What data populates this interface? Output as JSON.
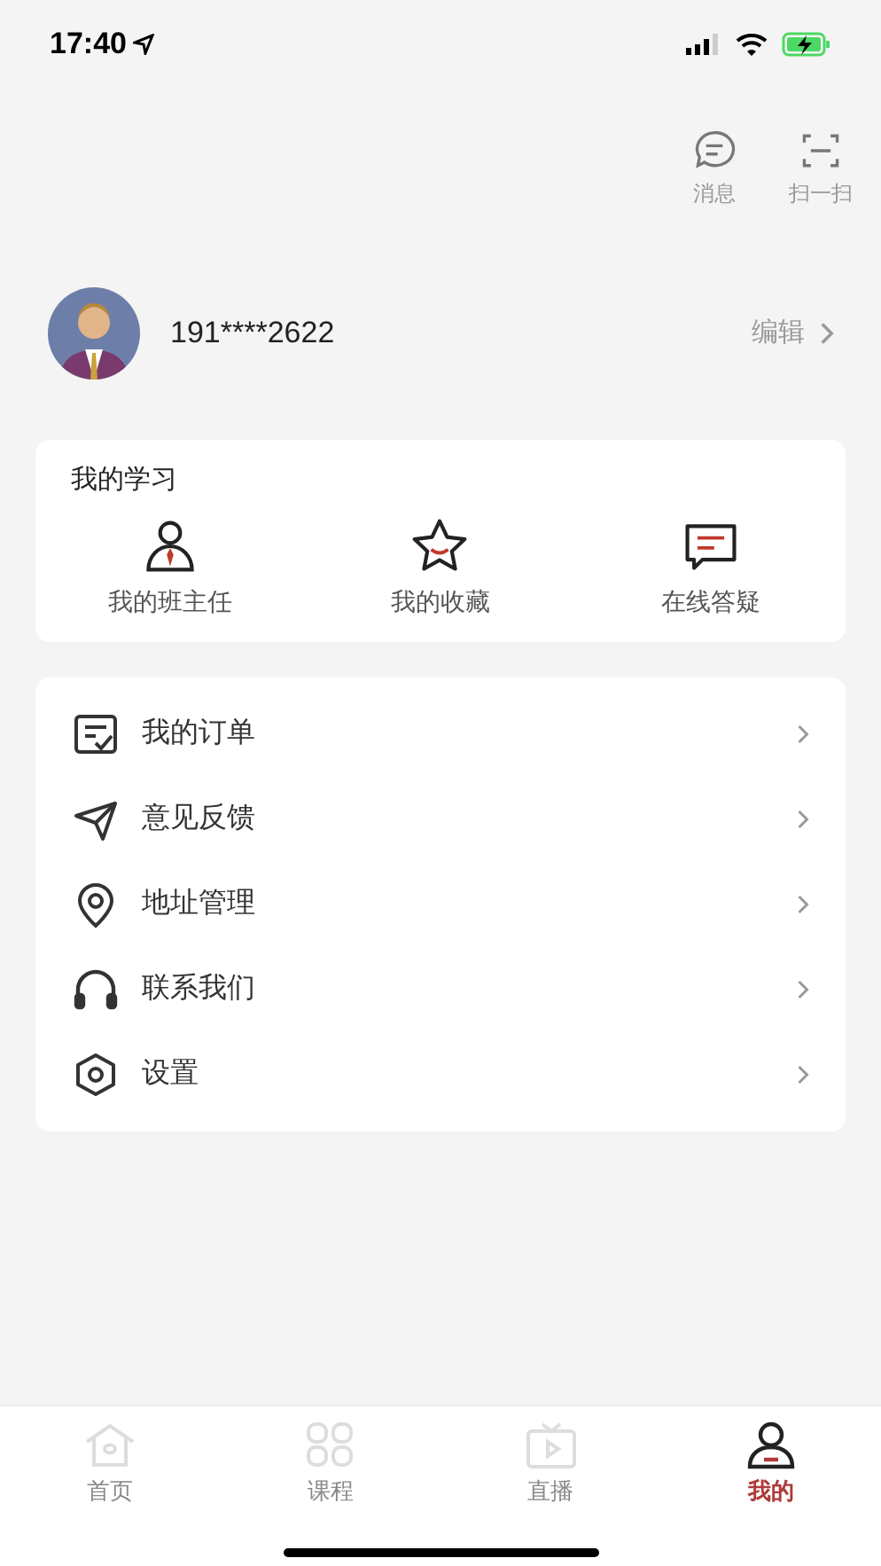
{
  "status_bar": {
    "time": "17:40"
  },
  "header_actions": [
    {
      "label": "消息"
    },
    {
      "label": "扫一扫"
    }
  ],
  "profile": {
    "phone": "191****2622",
    "edit": "编辑"
  },
  "study": {
    "title": "我的学习",
    "items": [
      {
        "label": "我的班主任"
      },
      {
        "label": "我的收藏"
      },
      {
        "label": "在线答疑"
      }
    ]
  },
  "menu": [
    {
      "label": "我的订单"
    },
    {
      "label": "意见反馈"
    },
    {
      "label": "地址管理"
    },
    {
      "label": "联系我们"
    },
    {
      "label": "设置"
    }
  ],
  "tabs": [
    {
      "label": "首页",
      "selected": false
    },
    {
      "label": "课程",
      "selected": false
    },
    {
      "label": "直播",
      "selected": false
    },
    {
      "label": "我的",
      "selected": true
    }
  ]
}
